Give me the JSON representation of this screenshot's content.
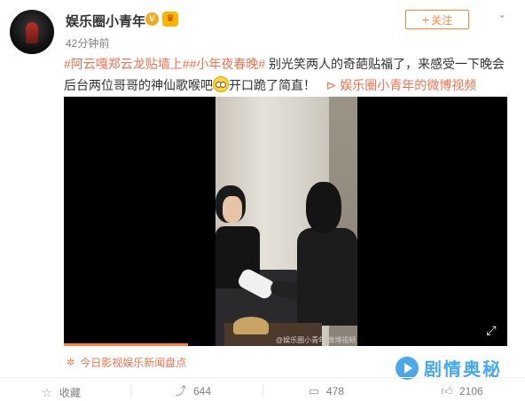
{
  "header": {
    "username": "娱乐圈小青年",
    "verified_badge": "V",
    "member_badge": "crown-badge-icon",
    "timestamp": "42分钟前",
    "follow_label": "关注",
    "follow_icon": "+",
    "more_icon": "chevron-down-icon"
  },
  "post": {
    "topic1": "#阿云嘎郑云龙贴墙上#",
    "topic2": "#小年夜春晚#",
    "text1": " 别光笑两人的奇葩贴福了，来感受一下晚会后台两位哥哥的神仙歌喉吧",
    "text2": "开口跪了简直！",
    "video_link_icon": "play-link-icon",
    "video_link": "娱乐圈小青年的微博视频"
  },
  "video": {
    "watermark": "@娱乐圈小青年 微博视频",
    "expand_icon": "expand-icon",
    "progress_fraction": 0.28
  },
  "source": {
    "icon": "sparkle-icon",
    "label": "今日影视娱乐新闻盘点"
  },
  "actions": {
    "favorite_label": "收藏",
    "repost_count": "644",
    "comment_count": "478",
    "like_count": "2106"
  },
  "site_logo": {
    "name": "剧情奥秘"
  },
  "colors": {
    "accent": "#eb7350",
    "follow": "#ff8140",
    "logo": "#4aa8ea"
  }
}
